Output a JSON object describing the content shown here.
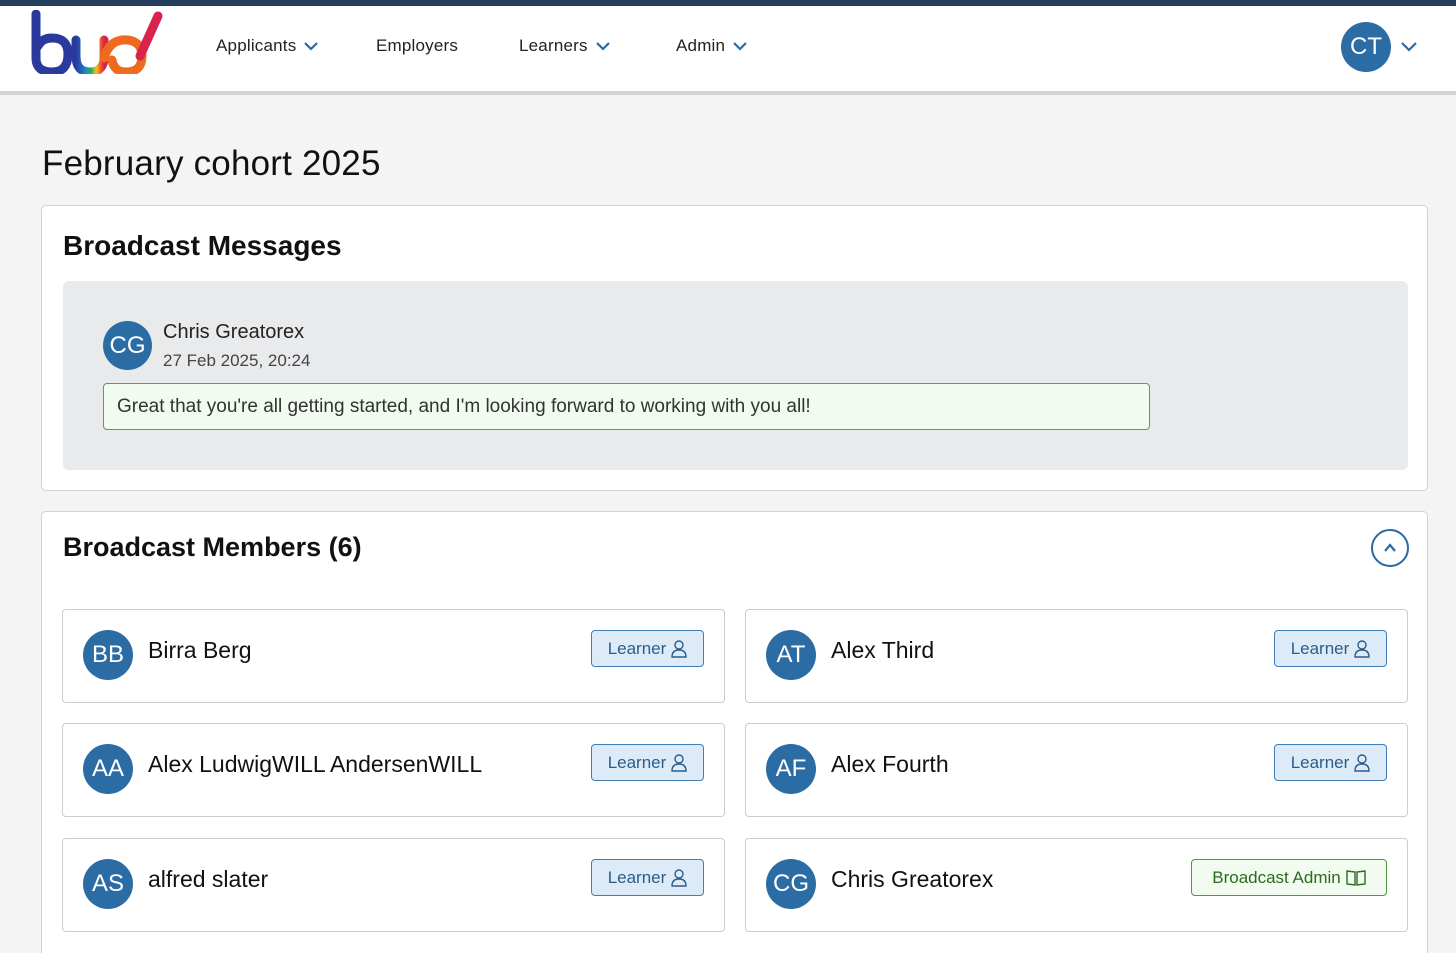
{
  "nav": {
    "items": [
      {
        "label": "Applicants",
        "dropdown": true
      },
      {
        "label": "Employers",
        "dropdown": false
      },
      {
        "label": "Learners",
        "dropdown": true
      },
      {
        "label": "Admin",
        "dropdown": true
      }
    ],
    "user_initials": "CT"
  },
  "page": {
    "title": "February cohort 2025"
  },
  "messages": {
    "title": "Broadcast Messages",
    "items": [
      {
        "initials": "CG",
        "author": "Chris Greatorex",
        "time": "27 Feb 2025, 20:24",
        "body": "Great that you're all getting started, and I'm looking forward to working with you all!"
      }
    ]
  },
  "members": {
    "title": "Broadcast Members (6)",
    "items": [
      {
        "initials": "BB",
        "name": "Birra Berg",
        "role": "Learner"
      },
      {
        "initials": "AT",
        "name": "Alex Third",
        "role": "Learner"
      },
      {
        "initials": "AA",
        "name": "Alex LudwigWILL AndersenWILL",
        "role": "Learner"
      },
      {
        "initials": "AF",
        "name": "Alex Fourth",
        "role": "Learner"
      },
      {
        "initials": "AS",
        "name": "alfred slater",
        "role": "Learner"
      },
      {
        "initials": "CG",
        "name": "Chris Greatorex",
        "role": "Broadcast Admin"
      }
    ]
  },
  "colors": {
    "primary": "#2c6ca4",
    "success": "#4d9a3f",
    "header_strip": "#233e5c"
  },
  "icons": {
    "learner": "person-icon",
    "admin": "book-icon",
    "collapse": "chevron-up-icon"
  }
}
